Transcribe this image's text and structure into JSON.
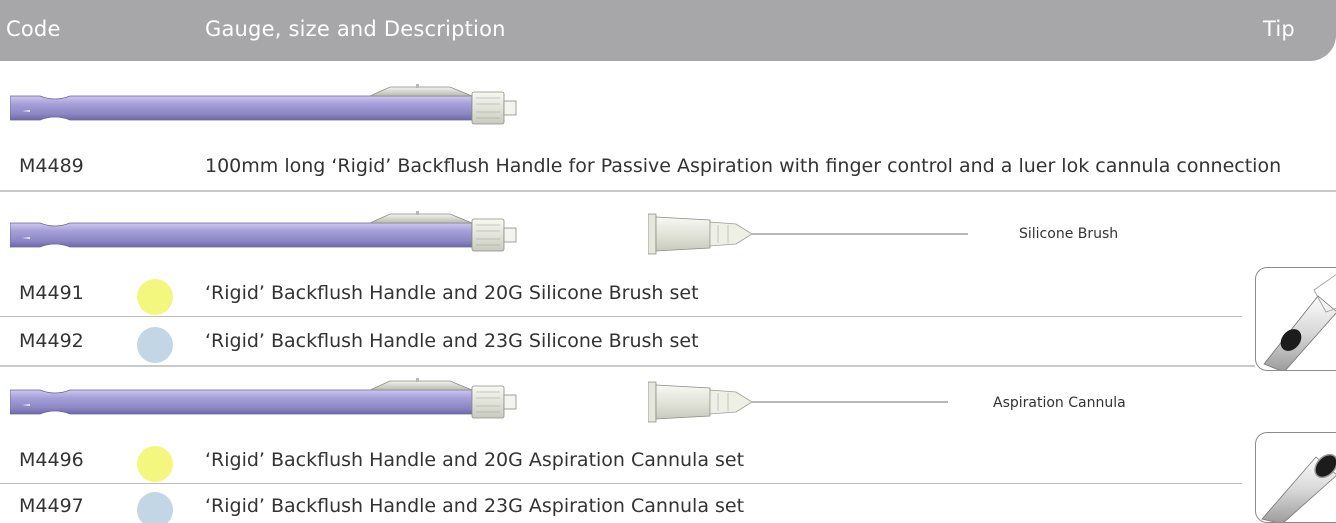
{
  "header": {
    "code": "Code",
    "description": "Gauge, size and Description",
    "tip": "Tip"
  },
  "rows": [
    {
      "code": "M4489",
      "description": "100mm long ‘Rigid’ Backflush Handle for Passive Aspiration with finger control and a luer lok cannula connection"
    },
    {
      "code": "M4491",
      "description": "‘Rigid’ Backflush Handle and 20G Silicone Brush set",
      "gauge_color": "#f3f77e"
    },
    {
      "code": "M4492",
      "description": "‘Rigid’ Backflush Handle and 23G Silicone Brush set",
      "gauge_color": "#c3d6e6"
    },
    {
      "code": "M4496",
      "description": "‘Rigid’ Backflush Handle and 20G Aspiration Cannula set",
      "gauge_color": "#f3f77e"
    },
    {
      "code": "M4497",
      "description": "‘Rigid’ Backflush Handle and 23G Aspiration Cannula set",
      "gauge_color": "#c3d6e6"
    }
  ],
  "captions": {
    "brush": "Silicone Brush",
    "cannula": "Aspiration Cannula"
  },
  "colors": {
    "header": "#a7a7a9",
    "handle": "#9b95cf",
    "gauge_20": "#f3f77e",
    "gauge_23": "#c3d6e6"
  }
}
